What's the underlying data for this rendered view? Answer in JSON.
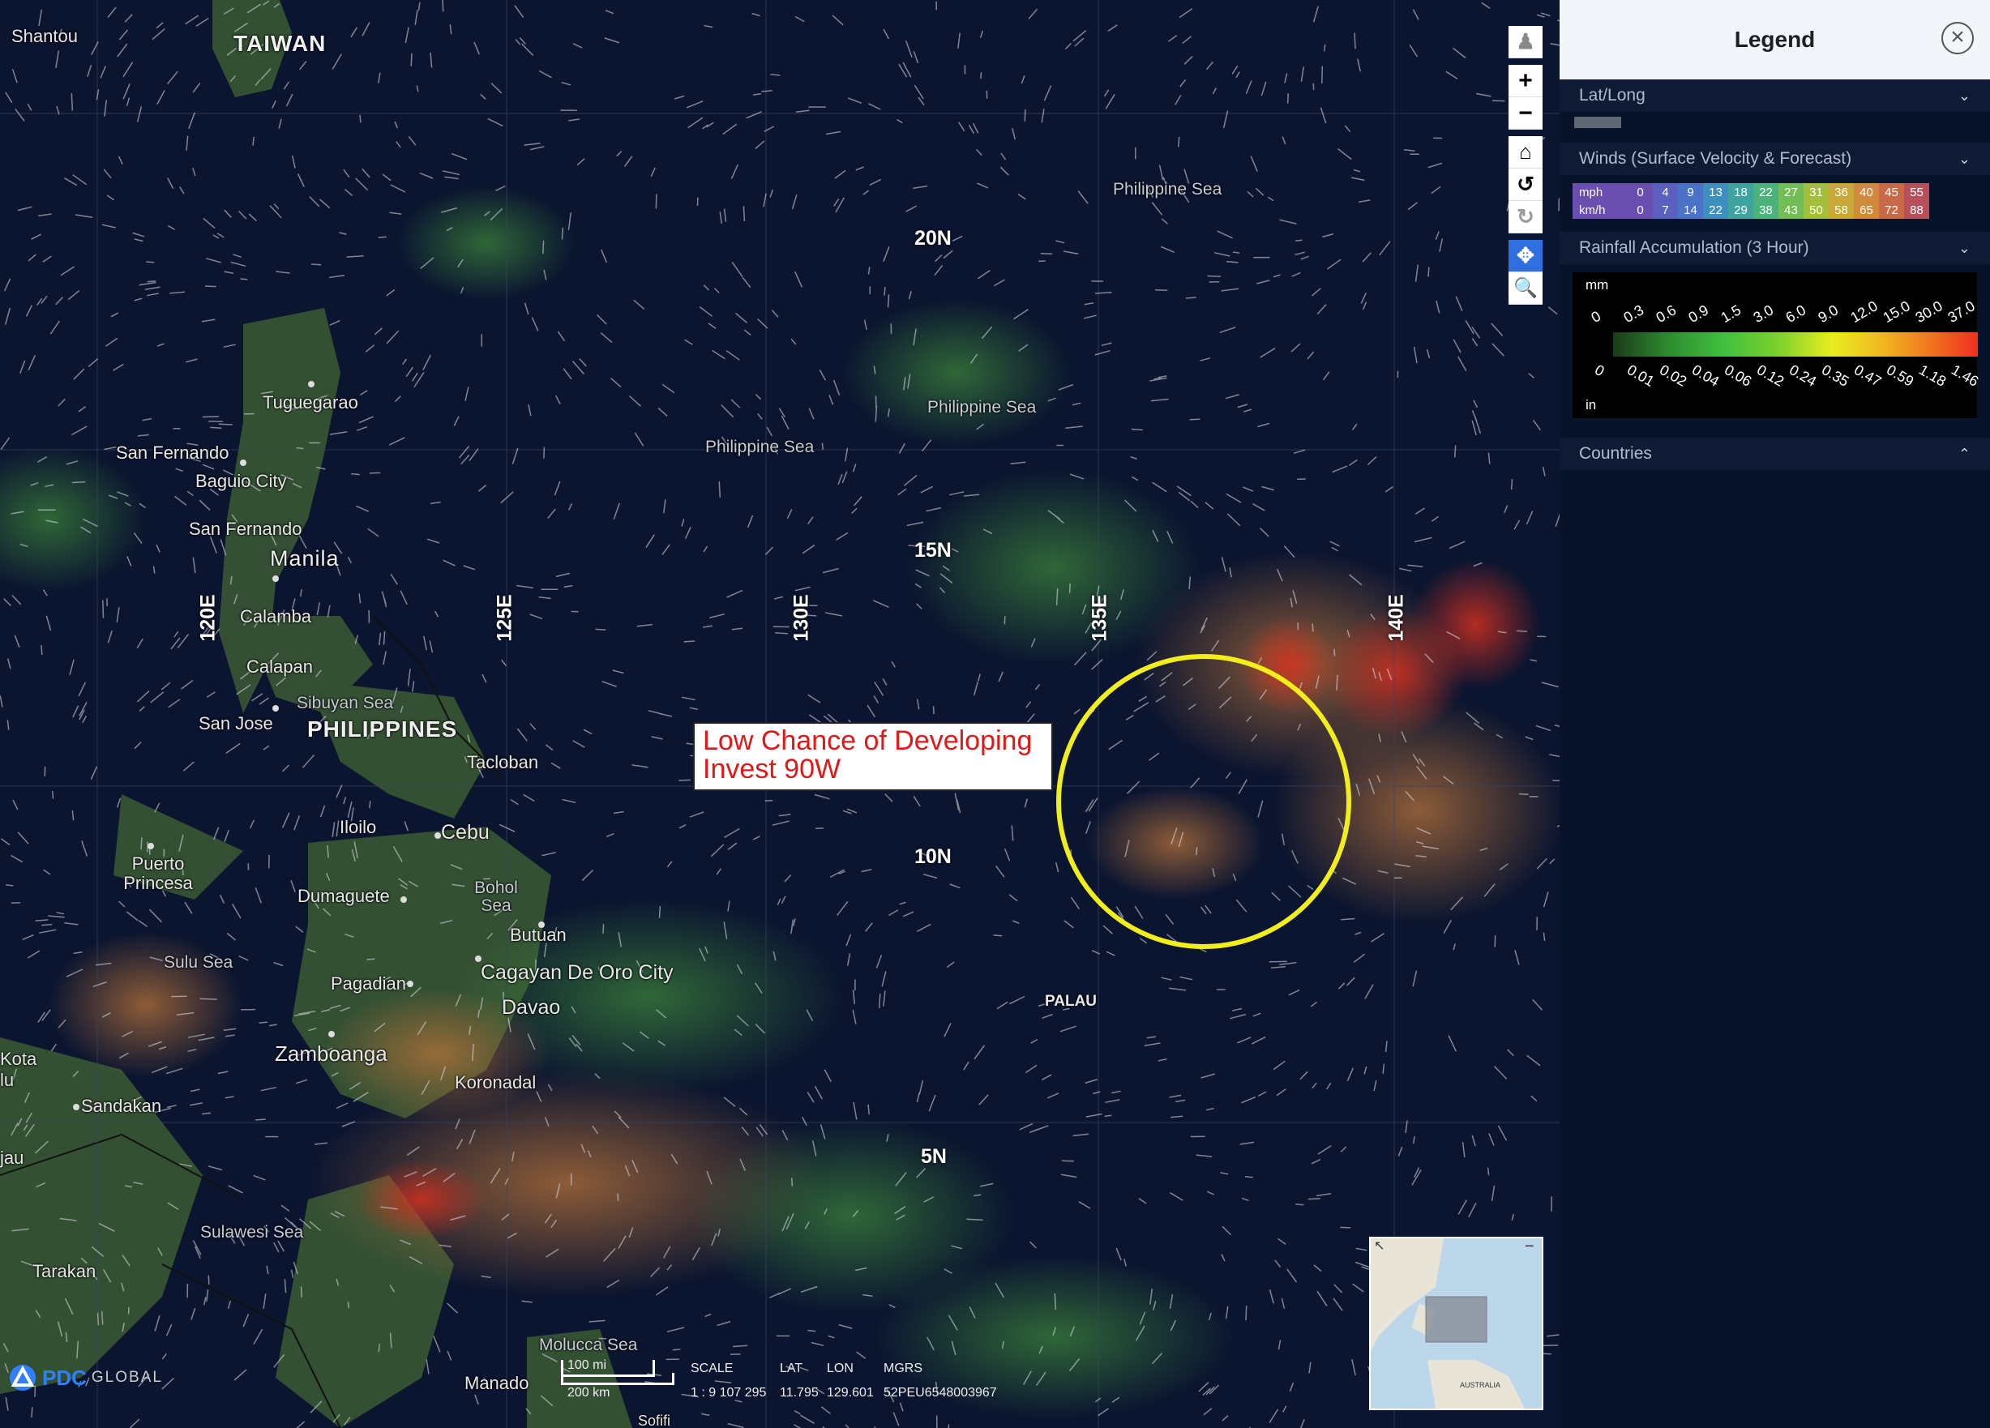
{
  "map": {
    "places": [
      {
        "name": "Shantou",
        "kind": "city"
      },
      {
        "name": "TAIWAN",
        "kind": "country"
      },
      {
        "name": "Tuguegarao",
        "kind": "city"
      },
      {
        "name": "San Fernando",
        "kind": "city"
      },
      {
        "name": "Baguio City",
        "kind": "city"
      },
      {
        "name": "San Fernando",
        "kind": "city"
      },
      {
        "name": "Manila",
        "kind": "city"
      },
      {
        "name": "Calamba",
        "kind": "city"
      },
      {
        "name": "Calapan",
        "kind": "city"
      },
      {
        "name": "Sibuyan Sea",
        "kind": "sea"
      },
      {
        "name": "San Jose",
        "kind": "city"
      },
      {
        "name": "PHILIPPINES",
        "kind": "country"
      },
      {
        "name": "Tacloban",
        "kind": "city"
      },
      {
        "name": "Iloilo",
        "kind": "city"
      },
      {
        "name": "Cebu",
        "kind": "city"
      },
      {
        "name": "Puerto Princesa",
        "kind": "city"
      },
      {
        "name": "Dumaguete",
        "kind": "city"
      },
      {
        "name": "Bohol Sea",
        "kind": "sea"
      },
      {
        "name": "Butuan",
        "kind": "city"
      },
      {
        "name": "Sulu Sea",
        "kind": "sea"
      },
      {
        "name": "Pagadian",
        "kind": "city"
      },
      {
        "name": "Cagayan De Oro City",
        "kind": "city"
      },
      {
        "name": "Davao",
        "kind": "city"
      },
      {
        "name": "Zamboanga",
        "kind": "city"
      },
      {
        "name": "Koronadal",
        "kind": "city"
      },
      {
        "name": "Sandakan",
        "kind": "city"
      },
      {
        "name": "Sulawesi Sea",
        "kind": "sea"
      },
      {
        "name": "Tarakan",
        "kind": "city"
      },
      {
        "name": "Molucca Sea",
        "kind": "sea"
      },
      {
        "name": "Manado",
        "kind": "city"
      },
      {
        "name": "Philippine Sea",
        "kind": "sea"
      },
      {
        "name": "Philippine Sea",
        "kind": "sea"
      },
      {
        "name": "Philippine Sea",
        "kind": "sea"
      },
      {
        "name": "PALAU",
        "kind": "country"
      },
      {
        "name": "Kota",
        "kind": "city"
      },
      {
        "name": "lu",
        "kind": "city"
      },
      {
        "name": "jau",
        "kind": "city"
      },
      {
        "name": "Sofifi",
        "kind": "city"
      }
    ],
    "lat_labels": [
      "20N",
      "15N",
      "10N",
      "5N"
    ],
    "lon_labels": [
      "120E",
      "125E",
      "130E",
      "135E",
      "140E"
    ],
    "callout": {
      "line1": "Low Chance of Developing",
      "line2": "Invest 90W"
    },
    "circle_color": "#f2ee1c"
  },
  "toolbar": {
    "buttons": [
      {
        "name": "street-view-button",
        "icon": "pegman-icon"
      },
      {
        "name": "zoom-in-button",
        "icon": "plus-icon"
      },
      {
        "name": "zoom-out-button",
        "icon": "minus-icon"
      },
      {
        "name": "home-button",
        "icon": "home-icon"
      },
      {
        "name": "rotate-left-button",
        "icon": "rotate-left-icon"
      },
      {
        "name": "rotate-right-button",
        "icon": "rotate-right-icon"
      },
      {
        "name": "pan-button",
        "icon": "move-icon"
      },
      {
        "name": "zoom-box-button",
        "icon": "magnifier-icon"
      }
    ]
  },
  "status": {
    "scale_mi": "100 mi",
    "scale_km": "200 km",
    "scale_label": "SCALE",
    "scale_value": "1 : 9 107 295",
    "lat_label": "LAT",
    "lat_value": "11.795",
    "lon_label": "LON",
    "lon_value": "129.601",
    "mgrs_label": "MGRS",
    "mgrs_value": "52PEU6548003967"
  },
  "logo": {
    "brand": "PDC",
    "suffix": "GLOBAL"
  },
  "minimap": {
    "label": "AUSTRALIA"
  },
  "legend": {
    "title": "Legend",
    "close_icon": "close-icon",
    "sections": {
      "latlong": {
        "title": "Lat/Long",
        "expanded": true
      },
      "winds": {
        "title": "Winds (Surface Velocity & Forecast)",
        "expanded": true,
        "mph_label": "mph",
        "kmh_label": "km/h",
        "mph": [
          "0",
          "4",
          "9",
          "13",
          "18",
          "22",
          "27",
          "31",
          "36",
          "40",
          "45",
          "55"
        ],
        "kmh": [
          "0",
          "7",
          "14",
          "22",
          "29",
          "38",
          "43",
          "50",
          "58",
          "65",
          "72",
          "88"
        ],
        "colors": [
          "#6a4fb0",
          "#5b5fc0",
          "#4a73c8",
          "#3e8fbe",
          "#3fa3a0",
          "#4cb27c",
          "#72bd55",
          "#a5be3c",
          "#c9a838",
          "#d08a3c",
          "#c86a48",
          "#b8505c"
        ]
      },
      "rainfall": {
        "title": "Rainfall Accumulation (3 Hour)",
        "expanded": true,
        "mm_label": "mm",
        "in_label": "in",
        "mm_ticks": [
          "0",
          "0.3",
          "0.6",
          "0.9",
          "1.5",
          "3.0",
          "6.0",
          "9.0",
          "12.0",
          "15.0",
          "30.0",
          "37.0"
        ],
        "in_ticks": [
          "0",
          "0.01",
          "0.02",
          "0.04",
          "0.06",
          "0.12",
          "0.24",
          "0.35",
          "0.47",
          "0.59",
          "1.18",
          "1.46"
        ]
      },
      "countries": {
        "title": "Countries",
        "expanded": false
      }
    }
  }
}
